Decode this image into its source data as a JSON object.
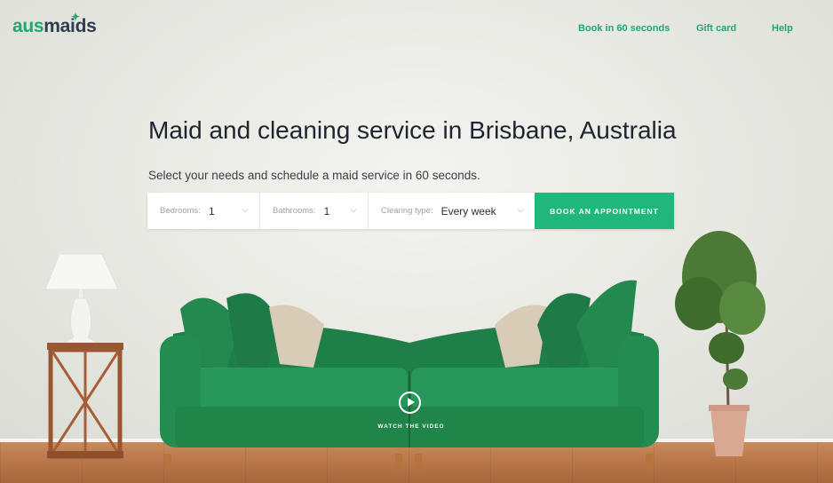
{
  "brand": {
    "logo_part1": "aus",
    "logo_part2": "maids"
  },
  "nav": {
    "book": "Book in 60 seconds",
    "gift": "Gift card",
    "help": "Help"
  },
  "hero": {
    "title": "Maid and cleaning service in Brisbane, Australia",
    "subtitle": "Select your needs and schedule a maid service in 60 seconds."
  },
  "booking": {
    "bedrooms": {
      "label": "Bedrooms:",
      "value": "1"
    },
    "bathrooms": {
      "label": "Bathrooms:",
      "value": "1"
    },
    "cleaning_type": {
      "label": "Clearing type:",
      "value": "Every week"
    },
    "button": "BOOK AN APPOINTMENT"
  },
  "video": {
    "label": "WATCH THE VIDEO"
  },
  "colors": {
    "accent": "#1fb87a",
    "logo_dark": "#2c3e50",
    "sofa": "#228a52"
  }
}
